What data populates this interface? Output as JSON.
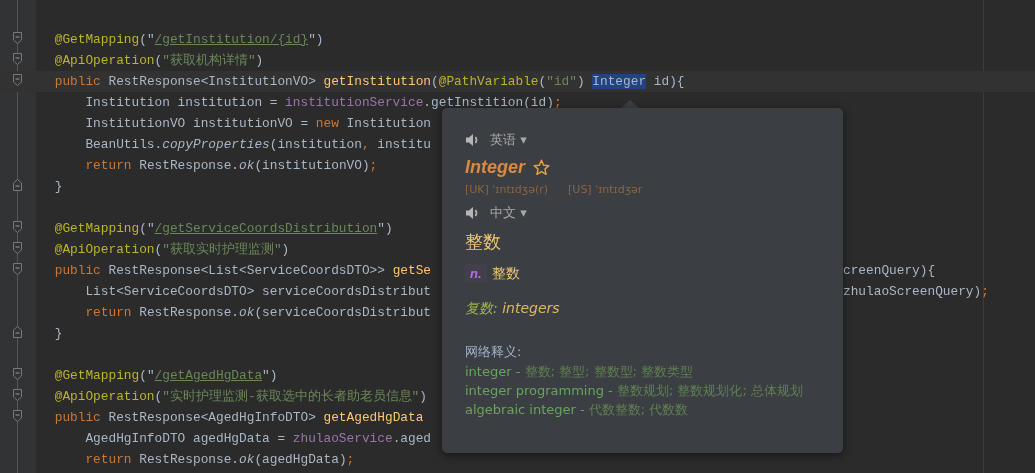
{
  "editor": {
    "lines": [
      {
        "kind": "blank"
      },
      {
        "kind": "fold-start",
        "tokens": [
          {
            "kind": "annotation",
            "text": "    @GetMapping"
          },
          {
            "kind": "plain",
            "text": "(\""
          },
          {
            "kind": "link",
            "text": "/getInstitution/{id}"
          },
          {
            "kind": "plain",
            "text": "\")"
          }
        ]
      },
      {
        "kind": "fold-start",
        "tokens": [
          {
            "kind": "annotation",
            "text": "    @ApiOperation"
          },
          {
            "kind": "plain",
            "text": "("
          },
          {
            "kind": "string",
            "text": "\"获取机构详情\""
          },
          {
            "kind": "plain",
            "text": ")"
          }
        ]
      },
      {
        "kind": "fold-start",
        "current": true,
        "tokens": [
          {
            "kind": "keyword",
            "text": "    public "
          },
          {
            "kind": "plain",
            "text": "RestResponse<InstitutionVO> "
          },
          {
            "kind": "method",
            "text": "getInstitution"
          },
          {
            "kind": "plain",
            "text": "("
          },
          {
            "kind": "annotation",
            "text": "@PathVariable"
          },
          {
            "kind": "plain",
            "text": "("
          },
          {
            "kind": "string",
            "text": "\"id\""
          },
          {
            "kind": "plain",
            "text": ") "
          },
          {
            "kind": "selected",
            "text": "Integer"
          },
          {
            "kind": "plain",
            "text": " id){"
          }
        ]
      },
      {
        "kind": "plain",
        "tokens": [
          {
            "kind": "plain",
            "text": "        Institution institution = "
          },
          {
            "kind": "field",
            "text": "institutionService"
          },
          {
            "kind": "plain",
            "text": ".getInstition(id)"
          },
          {
            "kind": "keyword",
            "text": ";"
          }
        ]
      },
      {
        "kind": "plain",
        "tokens": [
          {
            "kind": "plain",
            "text": "        InstitutionVO institutionVO = "
          },
          {
            "kind": "keyword",
            "text": "new "
          },
          {
            "kind": "plain",
            "text": "Institution"
          }
        ]
      },
      {
        "kind": "plain",
        "tokens": [
          {
            "kind": "plain",
            "text": "        BeanUtils."
          },
          {
            "kind": "static",
            "text": "copyProperties"
          },
          {
            "kind": "plain",
            "text": "(institution"
          },
          {
            "kind": "keyword",
            "text": ", "
          },
          {
            "kind": "plain",
            "text": "institu"
          }
        ]
      },
      {
        "kind": "plain",
        "tokens": [
          {
            "kind": "keyword",
            "text": "        return "
          },
          {
            "kind": "plain",
            "text": "RestResponse."
          },
          {
            "kind": "static",
            "text": "ok"
          },
          {
            "kind": "plain",
            "text": "(institutionVO)"
          },
          {
            "kind": "keyword",
            "text": ";"
          }
        ]
      },
      {
        "kind": "fold-end",
        "tokens": [
          {
            "kind": "plain",
            "text": "    }"
          }
        ]
      },
      {
        "kind": "blank"
      },
      {
        "kind": "fold-start",
        "tokens": [
          {
            "kind": "annotation",
            "text": "    @GetMapping"
          },
          {
            "kind": "plain",
            "text": "(\""
          },
          {
            "kind": "link",
            "text": "/getServiceCoordsDistribution"
          },
          {
            "kind": "plain",
            "text": "\")"
          }
        ]
      },
      {
        "kind": "fold-start",
        "tokens": [
          {
            "kind": "annotation",
            "text": "    @ApiOperation"
          },
          {
            "kind": "plain",
            "text": "("
          },
          {
            "kind": "string",
            "text": "\"获取实时护理监测\""
          },
          {
            "kind": "plain",
            "text": ")"
          }
        ]
      },
      {
        "kind": "fold-start",
        "tokens": [
          {
            "kind": "keyword",
            "text": "    public "
          },
          {
            "kind": "plain",
            "text": "RestResponse<List<ServiceCoordsDTO>> "
          },
          {
            "kind": "method",
            "text": "getSe"
          }
        ],
        "tail": [
          {
            "kind": "plain",
            "text": "creenQuery){"
          }
        ]
      },
      {
        "kind": "plain",
        "tokens": [
          {
            "kind": "plain",
            "text": "        List<ServiceCoordsDTO> serviceCoordsDistribut"
          }
        ],
        "tail": [
          {
            "kind": "plain",
            "text": "zhulaoScreenQuery)"
          },
          {
            "kind": "keyword",
            "text": ";"
          }
        ]
      },
      {
        "kind": "plain",
        "tokens": [
          {
            "kind": "keyword",
            "text": "        return "
          },
          {
            "kind": "plain",
            "text": "RestResponse."
          },
          {
            "kind": "static",
            "text": "ok"
          },
          {
            "kind": "plain",
            "text": "(serviceCoordsDistribut"
          }
        ]
      },
      {
        "kind": "fold-end",
        "tokens": [
          {
            "kind": "plain",
            "text": "    }"
          }
        ]
      },
      {
        "kind": "blank"
      },
      {
        "kind": "fold-start",
        "tokens": [
          {
            "kind": "annotation",
            "text": "    @GetMapping"
          },
          {
            "kind": "plain",
            "text": "(\""
          },
          {
            "kind": "link",
            "text": "/getAgedHgData"
          },
          {
            "kind": "plain",
            "text": "\")"
          }
        ]
      },
      {
        "kind": "fold-start",
        "tokens": [
          {
            "kind": "annotation",
            "text": "    @ApiOperation"
          },
          {
            "kind": "plain",
            "text": "("
          },
          {
            "kind": "string",
            "text": "\"实时护理监测-获取选中的长者助老员信息\""
          },
          {
            "kind": "plain",
            "text": ")"
          }
        ]
      },
      {
        "kind": "fold-start",
        "tokens": [
          {
            "kind": "keyword",
            "text": "    public "
          },
          {
            "kind": "plain",
            "text": "RestResponse<AgedHgInfoDTO> "
          },
          {
            "kind": "method",
            "text": "getAgedHgData"
          }
        ]
      },
      {
        "kind": "plain",
        "tokens": [
          {
            "kind": "plain",
            "text": "        AgedHgInfoDTO agedHgData = "
          },
          {
            "kind": "field",
            "text": "zhulaoService"
          },
          {
            "kind": "plain",
            "text": ".aged"
          }
        ]
      },
      {
        "kind": "plain",
        "tokens": [
          {
            "kind": "keyword",
            "text": "        return "
          },
          {
            "kind": "plain",
            "text": "RestResponse."
          },
          {
            "kind": "static",
            "text": "ok"
          },
          {
            "kind": "plain",
            "text": "(agedHgData)"
          },
          {
            "kind": "keyword",
            "text": ";"
          }
        ]
      }
    ]
  },
  "popup": {
    "source_lang": {
      "label": "英语",
      "caret": "▾"
    },
    "word": "Integer",
    "starred": false,
    "phonetics": [
      "[UK] ˈɪntɪdʒə(r)",
      "[US] ˈɪntɪdʒər"
    ],
    "target_lang": {
      "label": "中文",
      "caret": "▾"
    },
    "translation": "整数",
    "senses": [
      {
        "pos": "n.",
        "meaning": "整数"
      }
    ],
    "plural": {
      "label": "复数:",
      "value": "integers"
    },
    "web_heading": "网络释义:",
    "web_entries": [
      {
        "term": "integer",
        "separator": "-",
        "meanings": "整数; 整型; 整数型; 整数类型"
      },
      {
        "term": "integer programming",
        "separator": "-",
        "meanings": "整数规划; 整数规划化; 总体规划"
      },
      {
        "term": "algebraic integer",
        "separator": "-",
        "meanings": "代数整数; 代数数"
      }
    ]
  }
}
